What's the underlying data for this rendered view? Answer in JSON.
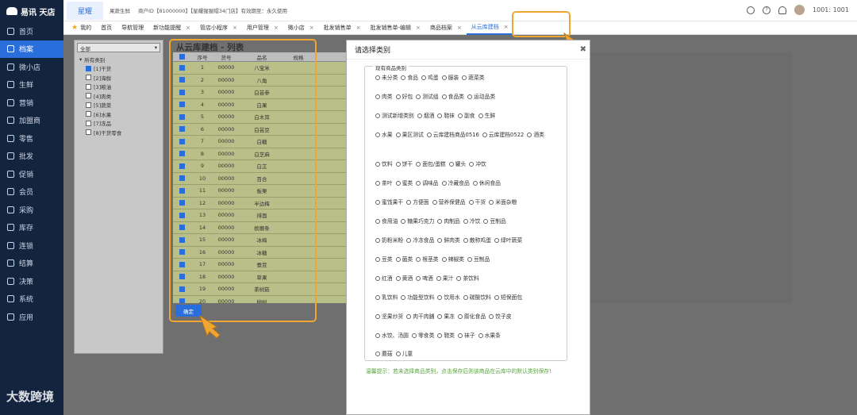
{
  "sidebar": {
    "logo": "易讯 天店",
    "items": [
      {
        "label": "首页"
      },
      {
        "label": "档案",
        "active": true
      },
      {
        "label": "微小店"
      },
      {
        "label": "生鲜"
      },
      {
        "label": "营销"
      },
      {
        "label": "加盟商"
      },
      {
        "label": "零售"
      },
      {
        "label": "批发"
      },
      {
        "label": "促销"
      },
      {
        "label": "会员"
      },
      {
        "label": "采购"
      },
      {
        "label": "库存"
      },
      {
        "label": "连锁"
      },
      {
        "label": "结算"
      },
      {
        "label": "决策"
      },
      {
        "label": "系统"
      },
      {
        "label": "应用"
      }
    ],
    "watermark": "大数跨境"
  },
  "topbar": {
    "brand": "星耀",
    "store": "果蔬生鲜",
    "merchant": "商户ID【81000000】【星耀猩猩帽34门店】有效期至：永久使用",
    "user": "1001: 1001"
  },
  "tabs": {
    "mine": "我的",
    "items": [
      {
        "label": "首页",
        "close": false
      },
      {
        "label": "导航管理",
        "close": false
      },
      {
        "label": "新功能提醒",
        "close": true
      },
      {
        "label": "管店小程序",
        "close": true
      },
      {
        "label": "用户管理",
        "close": true
      },
      {
        "label": "微小店",
        "close": true
      },
      {
        "label": "批发销售单",
        "close": true
      },
      {
        "label": "批发销售单-编辑",
        "close": true
      },
      {
        "label": "商品档案",
        "close": true
      },
      {
        "label": "从云库建档",
        "close": true,
        "active": true
      }
    ]
  },
  "category_panel": {
    "select": "全部",
    "root": "所有类别",
    "nodes": [
      {
        "label": "[1]干货",
        "checked": true
      },
      {
        "label": "[2]海鲜",
        "checked": false
      },
      {
        "label": "[3]粮油",
        "checked": false
      },
      {
        "label": "[4]肉类",
        "checked": false
      },
      {
        "label": "[5]蔬菜",
        "checked": false
      },
      {
        "label": "[6]水果",
        "checked": false
      },
      {
        "label": "[7]冻品",
        "checked": false
      },
      {
        "label": "[8]干货零食",
        "checked": false
      }
    ]
  },
  "list": {
    "title": "从云库建档 - 列表",
    "columns": [
      "序号",
      "货号",
      "品名",
      "规格"
    ],
    "rows": [
      [
        "1",
        "00000",
        "八宝米"
      ],
      [
        "2",
        "00000",
        "八角"
      ],
      [
        "3",
        "00000",
        "白芸参"
      ],
      [
        "4",
        "00000",
        "白果"
      ],
      [
        "5",
        "00000",
        "白木耳"
      ],
      [
        "6",
        "00000",
        "白芸豆"
      ],
      [
        "7",
        "00000",
        "白糖"
      ],
      [
        "8",
        "00000",
        "白芝麻"
      ],
      [
        "9",
        "00000",
        "白芷"
      ],
      [
        "10",
        "00000",
        "百合"
      ],
      [
        "11",
        "00000",
        "板栗"
      ],
      [
        "12",
        "00000",
        "半边梅"
      ],
      [
        "13",
        "00000",
        "排面"
      ],
      [
        "14",
        "00000",
        "槟榔条"
      ],
      [
        "15",
        "00000",
        "冰梅"
      ],
      [
        "16",
        "00000",
        "冰糖"
      ],
      [
        "17",
        "00000",
        "蚕豆"
      ],
      [
        "18",
        "00000",
        "草果"
      ],
      [
        "19",
        "00000",
        "茶树菇"
      ],
      [
        "20",
        "00000",
        "柳树"
      ]
    ],
    "confirm": "确定"
  },
  "dialog": {
    "title": "请选择类别",
    "legend": "现有商品类别",
    "rows": [
      [
        "未分类",
        "食品",
        "鸡蛋",
        "服装",
        "蔬菜类"
      ],
      [
        "肉类",
        "好包",
        "测试组",
        "食品类",
        "运动品类"
      ],
      [
        "测试新增类别",
        "烟酒",
        "鞋袜",
        "副食",
        "生鲜"
      ],
      [
        "水果",
        "果区测试",
        "云库建档商品0516",
        "云库建档0522",
        "酒类"
      ],
      [
        "饮料",
        "饼干",
        "面包/蛋糕",
        "罐头",
        "冲饮"
      ],
      [
        "茶叶",
        "蜜类",
        "调味品",
        "冷藏食品",
        "休闲食品"
      ],
      [
        "蜜饯果干",
        "方便面",
        "营养保健品",
        "干货",
        "米面杂粮"
      ],
      [
        "食用油",
        "糖果巧克力",
        "肉制品",
        "冷饮",
        "豆制品"
      ],
      [
        "奶粉米粉",
        "冷冻食品",
        "鲜肉类",
        "散称鸡蛋",
        "绿叶蔬菜"
      ],
      [
        "豆类",
        "菌类",
        "根茎类",
        "辣椒类",
        "豆制品"
      ],
      [
        "红酒",
        "黄酒",
        "啤酒",
        "果汁",
        "茶饮料"
      ],
      [
        "乳饮料",
        "功能型饮料",
        "饮用水",
        "碳酸饮料",
        "短保面包"
      ],
      [
        "坚果炒货",
        "肉干肉脯",
        "果冻",
        "膨化食品",
        "饺子皮"
      ],
      [
        "水饺、汤圆",
        "零食类",
        "鞋类",
        "袜子",
        "水果条"
      ],
      [
        "蘑菇",
        "儿童"
      ]
    ],
    "hint": "温馨提示：若未选择商品类别，点击保存后则该商品在云库中的默认类别保存!"
  },
  "colors": {
    "accent": "#2a6edc",
    "highlight": "#f0a632",
    "sidebar": "#13243f"
  }
}
